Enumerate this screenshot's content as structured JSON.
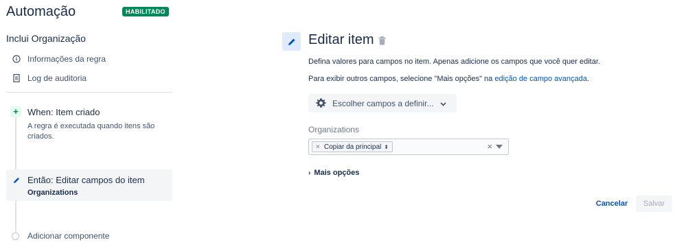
{
  "header": {
    "title": "Automação",
    "status_badge": "HABILITADO"
  },
  "rule": {
    "name": "Inclui Organização",
    "nav": [
      {
        "label": "Informações da regra",
        "icon": "info-icon"
      },
      {
        "label": "Log de auditoria",
        "icon": "document-icon"
      }
    ]
  },
  "flow": {
    "trigger": {
      "title": "When: Item criado",
      "description": "A regra é executada quando itens são criados.",
      "icon": "plus-icon"
    },
    "action": {
      "title": "Então: Editar campos do item",
      "subtitle": "Organizations",
      "icon": "pencil-icon"
    },
    "add_component": "Adicionar componente"
  },
  "editor": {
    "title": "Editar item",
    "description": "Defina valores para campos no item. Apenas adicione os campos que você quer editar.",
    "more_fields_text": "Para exibir outros campos, selecione \"Mais opções\" na",
    "more_fields_link": "edição de campo avançada",
    "more_fields_end": ".",
    "choose_fields_button": "Escolher campos a definir...",
    "field": {
      "label": "Organizations",
      "selected_value": "Copiar da principal"
    },
    "more_options": "Mais opções",
    "cancel": "Cancelar",
    "save": "Salvar"
  },
  "colors": {
    "badge": "#00875a",
    "link": "#0052cc",
    "text": "#172b4d",
    "muted": "#42526e"
  }
}
